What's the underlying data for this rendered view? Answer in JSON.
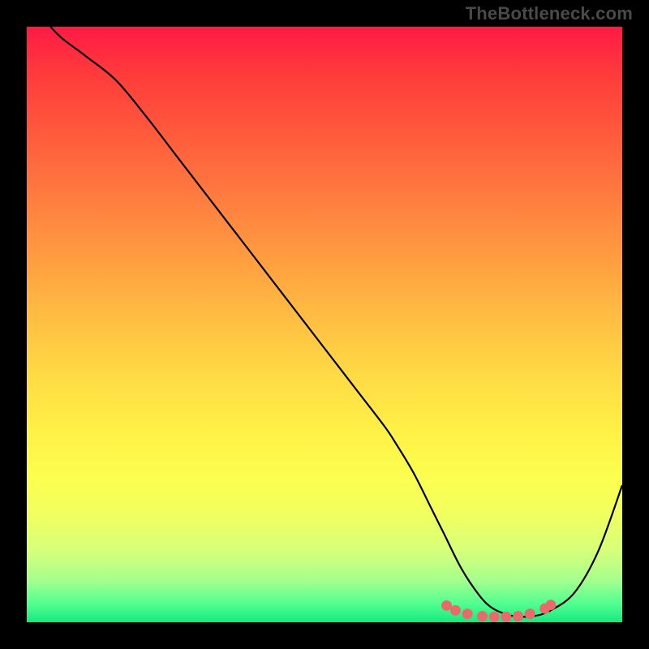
{
  "watermark": "TheBottleneck.com",
  "chart_data": {
    "type": "line",
    "title": "",
    "xlabel": "",
    "ylabel": "",
    "xlim": [
      0,
      100
    ],
    "ylim": [
      0,
      100
    ],
    "grid": false,
    "legend": false,
    "series": [
      {
        "name": "bottleneck-curve",
        "color": "#000000",
        "x": [
          4,
          6,
          10,
          15,
          20,
          25,
          30,
          35,
          40,
          45,
          50,
          55,
          60,
          62,
          65,
          68,
          70,
          73,
          76,
          78,
          80,
          82,
          85,
          88,
          92,
          96,
          100
        ],
        "y": [
          100,
          98,
          95,
          91,
          85,
          78.5,
          72,
          65.5,
          59,
          52.5,
          46,
          39.5,
          33,
          30,
          25,
          19,
          15,
          9,
          4.5,
          2.5,
          1.5,
          1,
          1,
          2,
          5,
          12,
          23
        ]
      }
    ],
    "highlights": {
      "name": "plateau-markers",
      "color": "#e86a6a",
      "points": [
        {
          "x": 70.5,
          "y": 2.8
        },
        {
          "x": 72,
          "y": 2.0
        },
        {
          "x": 74,
          "y": 1.4
        },
        {
          "x": 76.5,
          "y": 1.0
        },
        {
          "x": 78.5,
          "y": 0.9
        },
        {
          "x": 80.5,
          "y": 0.9
        },
        {
          "x": 82.5,
          "y": 1.0
        },
        {
          "x": 84.5,
          "y": 1.4
        },
        {
          "x": 87,
          "y": 2.3
        },
        {
          "x": 88,
          "y": 2.9
        }
      ]
    },
    "gradient_stops": [
      {
        "pos": 0.0,
        "color": "#ff1a44"
      },
      {
        "pos": 0.5,
        "color": "#ffd944"
      },
      {
        "pos": 0.8,
        "color": "#fbff4f"
      },
      {
        "pos": 1.0,
        "color": "#16e87e"
      }
    ]
  }
}
